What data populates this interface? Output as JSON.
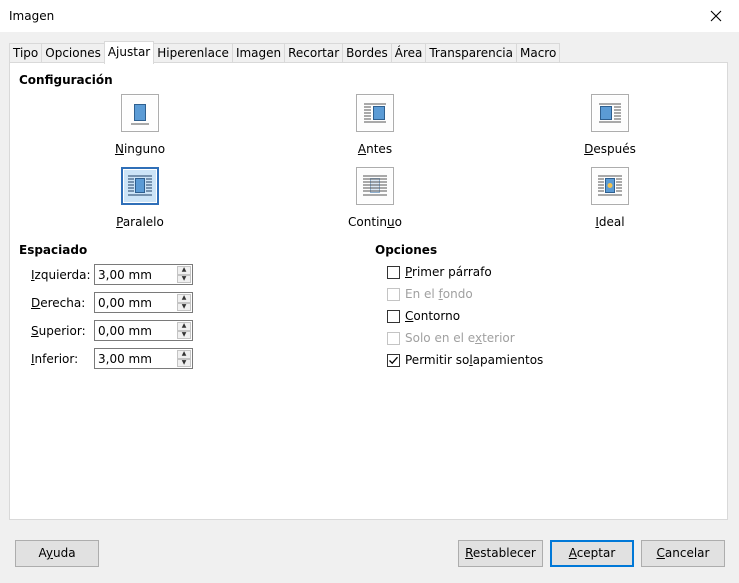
{
  "window": {
    "title": "Imagen"
  },
  "tabs": [
    "Tipo",
    "Opciones",
    "Ajustar",
    "Hiperenlace",
    "Imagen",
    "Recortar",
    "Bordes",
    "Área",
    "Transparencia",
    "Macro"
  ],
  "active_tab": "Ajustar",
  "configuracion": {
    "title": "Configuración",
    "options": [
      {
        "pre": "",
        "u": "N",
        "post": "inguno",
        "selected": false,
        "icon": "wrap-none-icon"
      },
      {
        "pre": "",
        "u": "A",
        "post": "ntes",
        "selected": false,
        "icon": "wrap-before-icon"
      },
      {
        "pre": "",
        "u": "D",
        "post": "espués",
        "selected": false,
        "icon": "wrap-after-icon"
      },
      {
        "pre": "",
        "u": "P",
        "post": "aralelo",
        "selected": true,
        "icon": "wrap-parallel-icon"
      },
      {
        "pre": "Contin",
        "u": "u",
        "post": "o",
        "selected": false,
        "icon": "wrap-through-icon"
      },
      {
        "pre": "",
        "u": "I",
        "post": "deal",
        "selected": false,
        "icon": "wrap-ideal-icon"
      }
    ]
  },
  "espaciado": {
    "title": "Espaciado",
    "fields": [
      {
        "pre": "",
        "u": "I",
        "post": "zquierda:",
        "value": "3,00 mm"
      },
      {
        "pre": "",
        "u": "D",
        "post": "erecha:",
        "value": "0,00 mm"
      },
      {
        "pre": "",
        "u": "S",
        "post": "uperior:",
        "value": "0,00 mm"
      },
      {
        "pre": "",
        "u": "I",
        "post": "nferior:",
        "value": "3,00 mm"
      }
    ]
  },
  "opciones": {
    "title": "Opciones",
    "items": [
      {
        "pre": "",
        "u": "P",
        "post": "rimer párrafo",
        "checked": false,
        "disabled": false
      },
      {
        "pre": "En el ",
        "u": "f",
        "post": "ondo",
        "checked": false,
        "disabled": true
      },
      {
        "pre": "",
        "u": "C",
        "post": "ontorno",
        "checked": false,
        "disabled": false
      },
      {
        "pre": "Solo en el e",
        "u": "x",
        "post": "terior",
        "checked": false,
        "disabled": true
      },
      {
        "pre": "Permitir so",
        "u": "l",
        "post": "apamientos",
        "checked": true,
        "disabled": false
      }
    ]
  },
  "buttons": {
    "help": {
      "pre": "A",
      "u": "y",
      "post": "uda"
    },
    "reset": {
      "pre": "",
      "u": "R",
      "post": "establecer"
    },
    "ok": {
      "pre": "",
      "u": "A",
      "post": "ceptar"
    },
    "cancel": {
      "pre": "",
      "u": "C",
      "post": "ancelar"
    }
  },
  "colors": {
    "selected_border": "#2f6fb8",
    "selected_fill": "#cce4f7",
    "page_blue": "#5b9bd5",
    "default_button_border": "#0078d7"
  }
}
